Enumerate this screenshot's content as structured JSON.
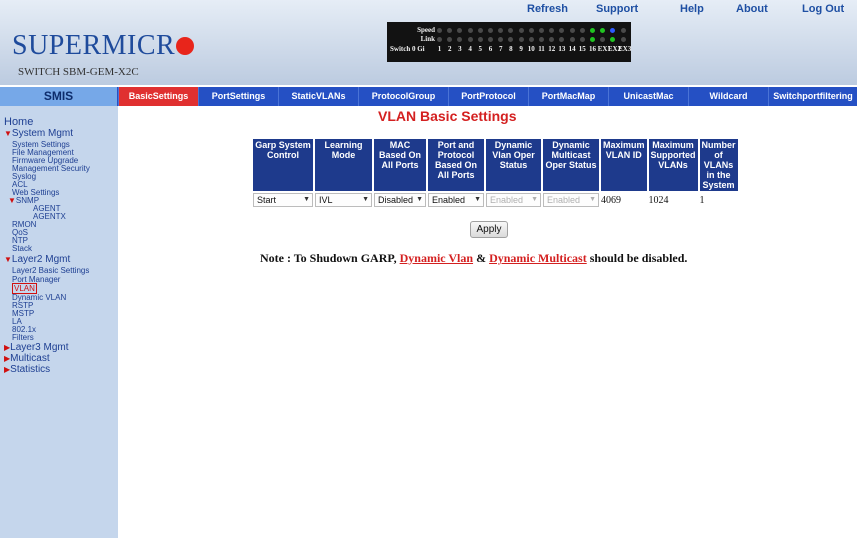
{
  "header": {
    "brand": "SUPERMICR",
    "model": "SWITCH SBM-GEM-X2C",
    "nav": [
      "Refresh",
      "Support",
      "Help",
      "About",
      "Log Out"
    ],
    "panel": {
      "speed_label": "Speed",
      "link_label": "Link",
      "ports_label": "Switch 0 Gi",
      "port_numbers": [
        "1",
        "2",
        "3",
        "4",
        "5",
        "6",
        "7",
        "8",
        "9",
        "10",
        "11",
        "12",
        "13",
        "14",
        "15",
        "16",
        "EX1",
        "EX2",
        "EX3"
      ]
    }
  },
  "tabs": {
    "smis": "SMIS",
    "items": [
      "BasicSettings",
      "PortSettings",
      "StaticVLANs",
      "ProtocolGroup",
      "PortProtocol",
      "PortMacMap",
      "UnicastMac",
      "Wildcard",
      "Switchportfiltering"
    ]
  },
  "sidebar": {
    "home": "Home",
    "system_mgmt": "System Mgmt",
    "system_items": [
      "System Settings",
      "File Management",
      "Firmware Upgrade",
      "Management Security",
      "Syslog",
      "ACL",
      "Web Settings"
    ],
    "snmp": "SNMP",
    "snmp_items": [
      "AGENT",
      "AGENTX"
    ],
    "system_items2": [
      "RMON",
      "QoS",
      "NTP",
      "Stack"
    ],
    "layer2_mgmt": "Layer2 Mgmt",
    "layer2_items": [
      "Layer2 Basic Settings",
      "Port Manager",
      "VLAN",
      "Dynamic VLAN",
      "RSTP",
      "MSTP",
      "LA",
      "802.1x",
      "Filters"
    ],
    "layer3_mgmt": "Layer3 Mgmt",
    "multicast": "Multicast",
    "statistics": "Statistics"
  },
  "main": {
    "title": "VLAN Basic Settings",
    "columns": [
      "Garp System Control",
      "Learning Mode",
      "MAC Based On All Ports",
      "Port and Protocol Based On All Ports",
      "Dynamic Vlan Oper Status",
      "Dynamic Multicast Oper Status",
      "Maximum VLAN ID",
      "Maximum Supported VLANs",
      "Number of VLANs in the System"
    ],
    "row": {
      "garp": "Start",
      "learning": "IVL",
      "mac_based": "Disabled",
      "port_protocol": "Enabled",
      "dyn_vlan": "Enabled",
      "dyn_multicast": "Enabled",
      "max_vlan_id": "4069",
      "max_supported": "1024",
      "num_vlans": "1"
    },
    "apply_label": "Apply",
    "note_prefix": "Note : To Shudown GARP,",
    "note_link1": "Dynamic Vlan",
    "note_amp": "&",
    "note_link2": "Dynamic Multicast",
    "note_suffix": "should be disabled."
  }
}
